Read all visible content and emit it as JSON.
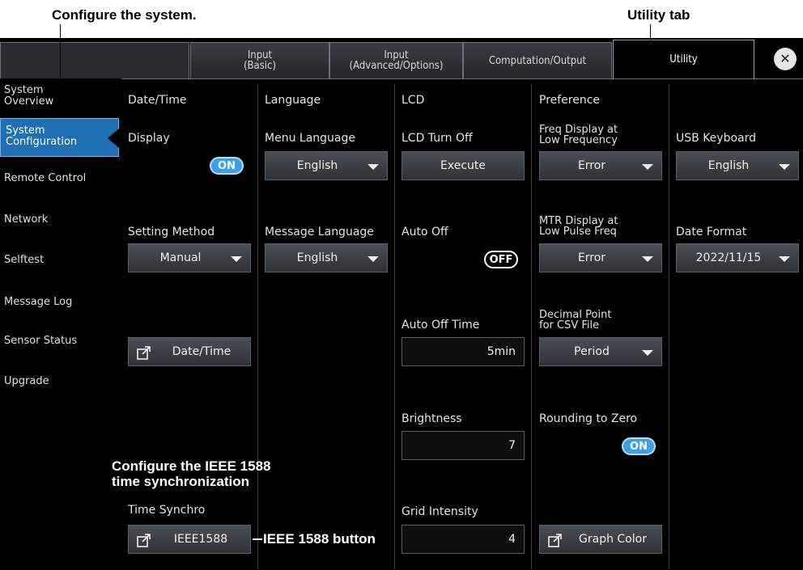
{
  "annotations": {
    "configure_system": "Configure the system.",
    "utility_tab": "Utility tab",
    "ieee_sync_line1": "Configure the IEEE 1588",
    "ieee_sync_line2": "time synchronization",
    "ieee_button": "IEEE 1588 button"
  },
  "tabs": [
    {
      "label": "Input\n(Basic)"
    },
    {
      "label": "Input\n(Advanced/Options)"
    },
    {
      "label": "Computation/Output"
    },
    {
      "label": "Utility"
    }
  ],
  "close_glyph": "✕",
  "sidebar": {
    "items": [
      {
        "label": "System\nOverview"
      },
      {
        "label": "System\nConfiguration"
      },
      {
        "label": "Remote Control"
      },
      {
        "label": "Network"
      },
      {
        "label": "Selftest"
      },
      {
        "label": "Message Log"
      },
      {
        "label": "Sensor Status"
      },
      {
        "label": "Upgrade"
      }
    ]
  },
  "datetime": {
    "header": "Date/Time",
    "display_label": "Display",
    "display_toggle": "ON",
    "setting_method_label": "Setting Method",
    "setting_method_value": "Manual",
    "datetime_button": "Date/Time",
    "time_synchro_label": "Time Synchro",
    "ieee_button": "IEEE1588"
  },
  "language": {
    "header": "Language",
    "menu_language_label": "Menu Language",
    "menu_language_value": "English",
    "message_language_label": "Message Language",
    "message_language_value": "English"
  },
  "lcd": {
    "header": "LCD",
    "turn_off_label": "LCD Turn Off",
    "execute_button": "Execute",
    "auto_off_label": "Auto Off",
    "auto_off_toggle": "OFF",
    "auto_off_time_label": "Auto Off Time",
    "auto_off_time_value": "5min",
    "brightness_label": "Brightness",
    "brightness_value": "7",
    "grid_intensity_label": "Grid Intensity",
    "grid_intensity_value": "4"
  },
  "preference": {
    "header": "Preference",
    "freq_label_1": "Freq Display at",
    "freq_label_2": "Low Frequency",
    "freq_value": "Error",
    "mtr_label_1": "MTR Display at",
    "mtr_label_2": "Low Pulse Freq",
    "mtr_value": "Error",
    "decimal_label_1": "Decimal Point",
    "decimal_label_2": "for CSV File",
    "decimal_value": "Period",
    "rounding_label": "Rounding to Zero",
    "rounding_toggle": "ON",
    "graph_color_button": "Graph Color",
    "usb_keyboard_label": "USB Keyboard",
    "usb_keyboard_value": "English",
    "date_format_label": "Date Format",
    "date_format_value": "2022/11/15"
  }
}
